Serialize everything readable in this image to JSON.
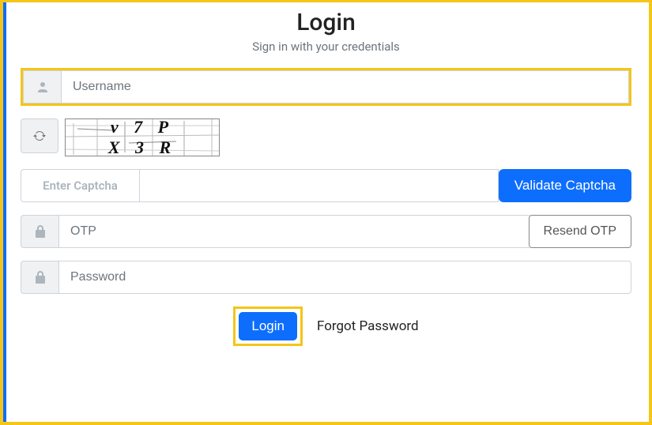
{
  "header": {
    "title": "Login",
    "subtitle": "Sign in with your credentials"
  },
  "fields": {
    "username_placeholder": "Username",
    "captcha_value": "v 7 P X 3 R",
    "enter_captcha_label": "Enter Captcha",
    "validate_captcha_label": "Validate Captcha",
    "otp_placeholder": "OTP",
    "resend_otp_label": "Resend OTP",
    "password_placeholder": "Password"
  },
  "actions": {
    "login_label": "Login",
    "forgot_label": "Forgot Password"
  }
}
